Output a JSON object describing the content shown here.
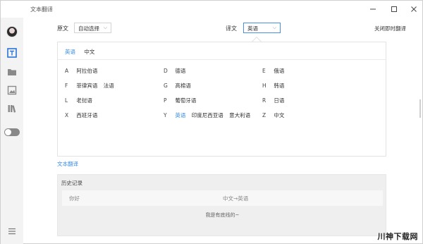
{
  "window": {
    "title": "文本翻译"
  },
  "header": {
    "source_label": "原文",
    "source_value": "自动选择",
    "target_label": "译文",
    "target_value": "英语",
    "close_instant": "关闭即时翻译"
  },
  "panel": {
    "tabs": [
      {
        "label": "英语",
        "active": true
      },
      {
        "label": "中文",
        "active": false
      }
    ],
    "rows": [
      [
        {
          "letter": "A",
          "items": [
            "阿拉伯语"
          ]
        },
        {
          "letter": "D",
          "items": [
            "德语"
          ]
        },
        {
          "letter": "E",
          "items": [
            "俄语"
          ]
        }
      ],
      [
        {
          "letter": "F",
          "items": [
            "菲律宾语",
            "法语"
          ]
        },
        {
          "letter": "G",
          "items": [
            "高棉语"
          ]
        },
        {
          "letter": "H",
          "items": [
            "韩语"
          ]
        }
      ],
      [
        {
          "letter": "L",
          "items": [
            "老挝语"
          ]
        },
        {
          "letter": "P",
          "items": [
            "葡萄牙语"
          ]
        },
        {
          "letter": "R",
          "items": [
            "日语"
          ]
        }
      ],
      [
        {
          "letter": "X",
          "items": [
            "西班牙语"
          ]
        },
        {
          "letter": "Y",
          "items": [
            "英语",
            "印度尼西亚语",
            "意大利语"
          ]
        },
        {
          "letter": "Z",
          "items": [
            "中文"
          ]
        }
      ]
    ],
    "selected": "英语"
  },
  "links": {
    "text_translate": "文本翻译"
  },
  "history": {
    "title": "历史记录",
    "rows": [
      {
        "source": "你好",
        "direction": "中文→英语"
      }
    ],
    "end_text": "我是有底线的~"
  },
  "watermark": "川神下载网",
  "icons": {
    "window_controls": [
      "minimize-icon",
      "maximize-icon",
      "close-icon"
    ],
    "sidebar": [
      "avatar",
      "text-translate-icon",
      "folder-icon",
      "image-icon",
      "books-icon",
      "toggle-switch",
      "menu-icon"
    ]
  },
  "colors": {
    "accent": "#3a8ee6",
    "sidebar_active": "#2a73d9"
  }
}
